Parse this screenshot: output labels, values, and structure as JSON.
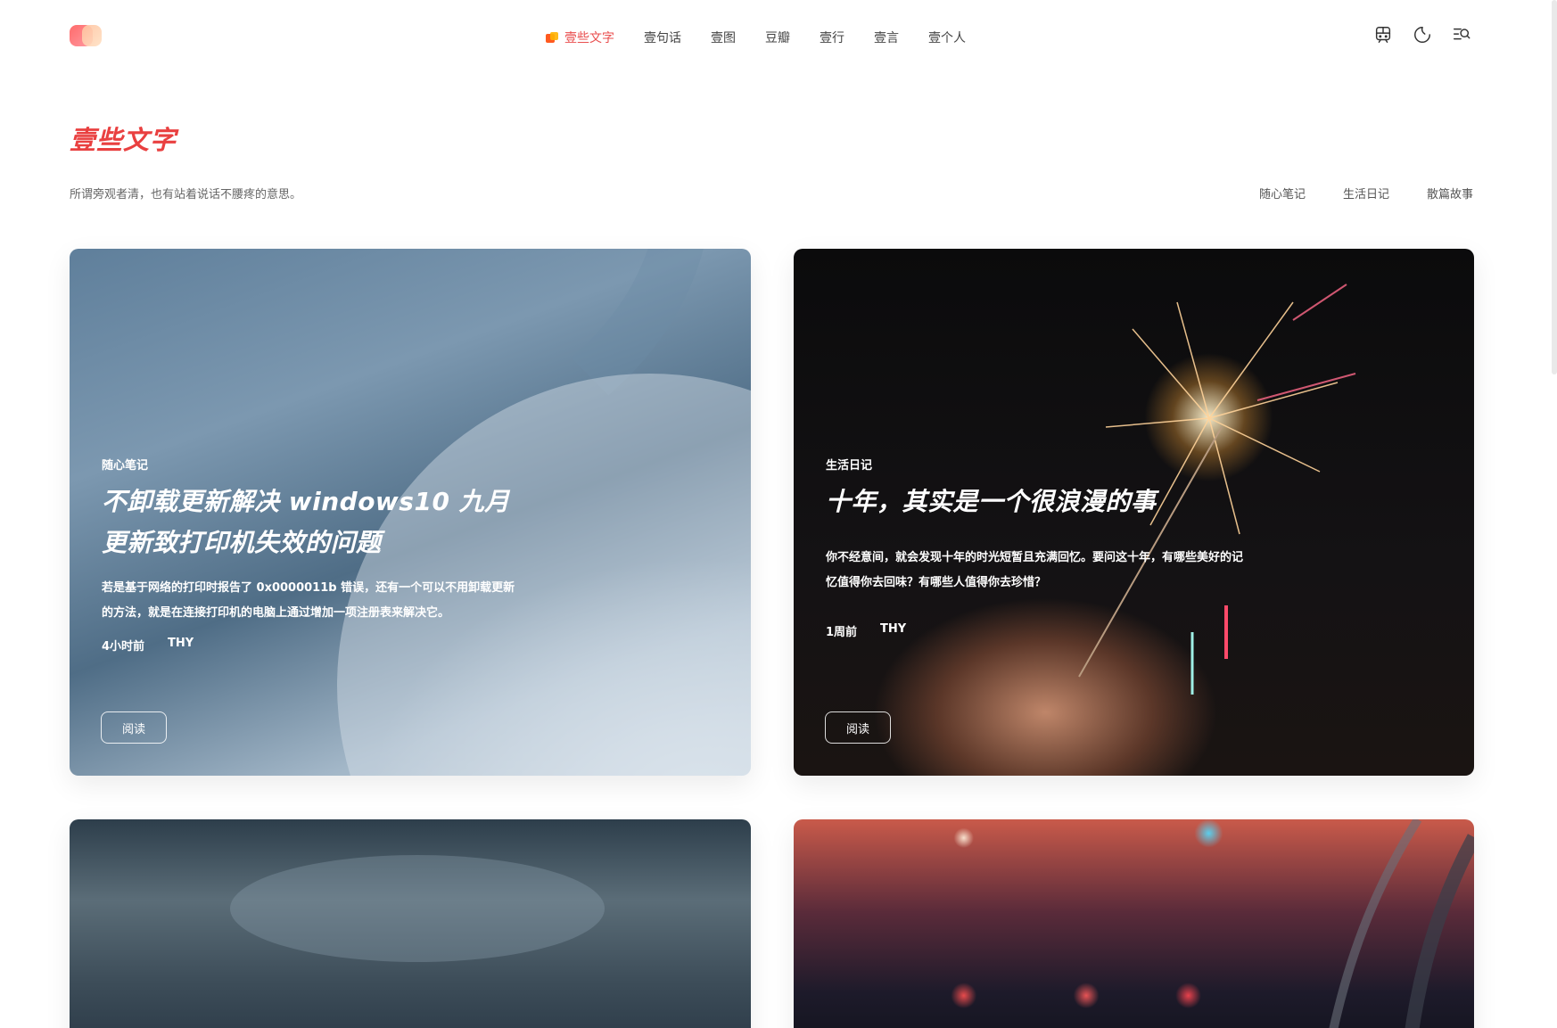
{
  "header": {
    "nav": [
      {
        "label": "壹些文字",
        "active": true
      },
      {
        "label": "壹句话",
        "active": false
      },
      {
        "label": "壹图",
        "active": false
      },
      {
        "label": "豆瓣",
        "active": false
      },
      {
        "label": "壹行",
        "active": false
      },
      {
        "label": "壹言",
        "active": false
      },
      {
        "label": "壹个人",
        "active": false
      }
    ],
    "tools": [
      "subway-icon",
      "moon-icon",
      "search-list-icon"
    ]
  },
  "section": {
    "title": "壹些文字",
    "subtitle": "所谓旁观者清，也有站着说话不腰疼的意思。",
    "categories": [
      "随心笔记",
      "生活日记",
      "散篇故事"
    ]
  },
  "posts": [
    {
      "category": "随心笔记",
      "title": "不卸载更新解决 windows10 九月更新致打印机失效的问题",
      "excerpt": "若是基于网络的打印时报告了 0x0000011b 错误，还有一个可以不用卸载更新的方法，就是在连接打印机的电脑上通过增加一项注册表来解决它。",
      "time": "4小时前",
      "author": "THY",
      "read_label": "阅读"
    },
    {
      "category": "生活日记",
      "title": "十年，其实是一个很浪漫的事",
      "excerpt": "你不经意间，就会发现十年的时光短暂且充满回忆。要问这十年，有哪些美好的记忆值得你去回味？有哪些人值得你去珍惜？",
      "time": "1周前",
      "author": "THY",
      "read_label": "阅读"
    }
  ],
  "colors": {
    "accent": "#e94040",
    "text": "#333333"
  }
}
